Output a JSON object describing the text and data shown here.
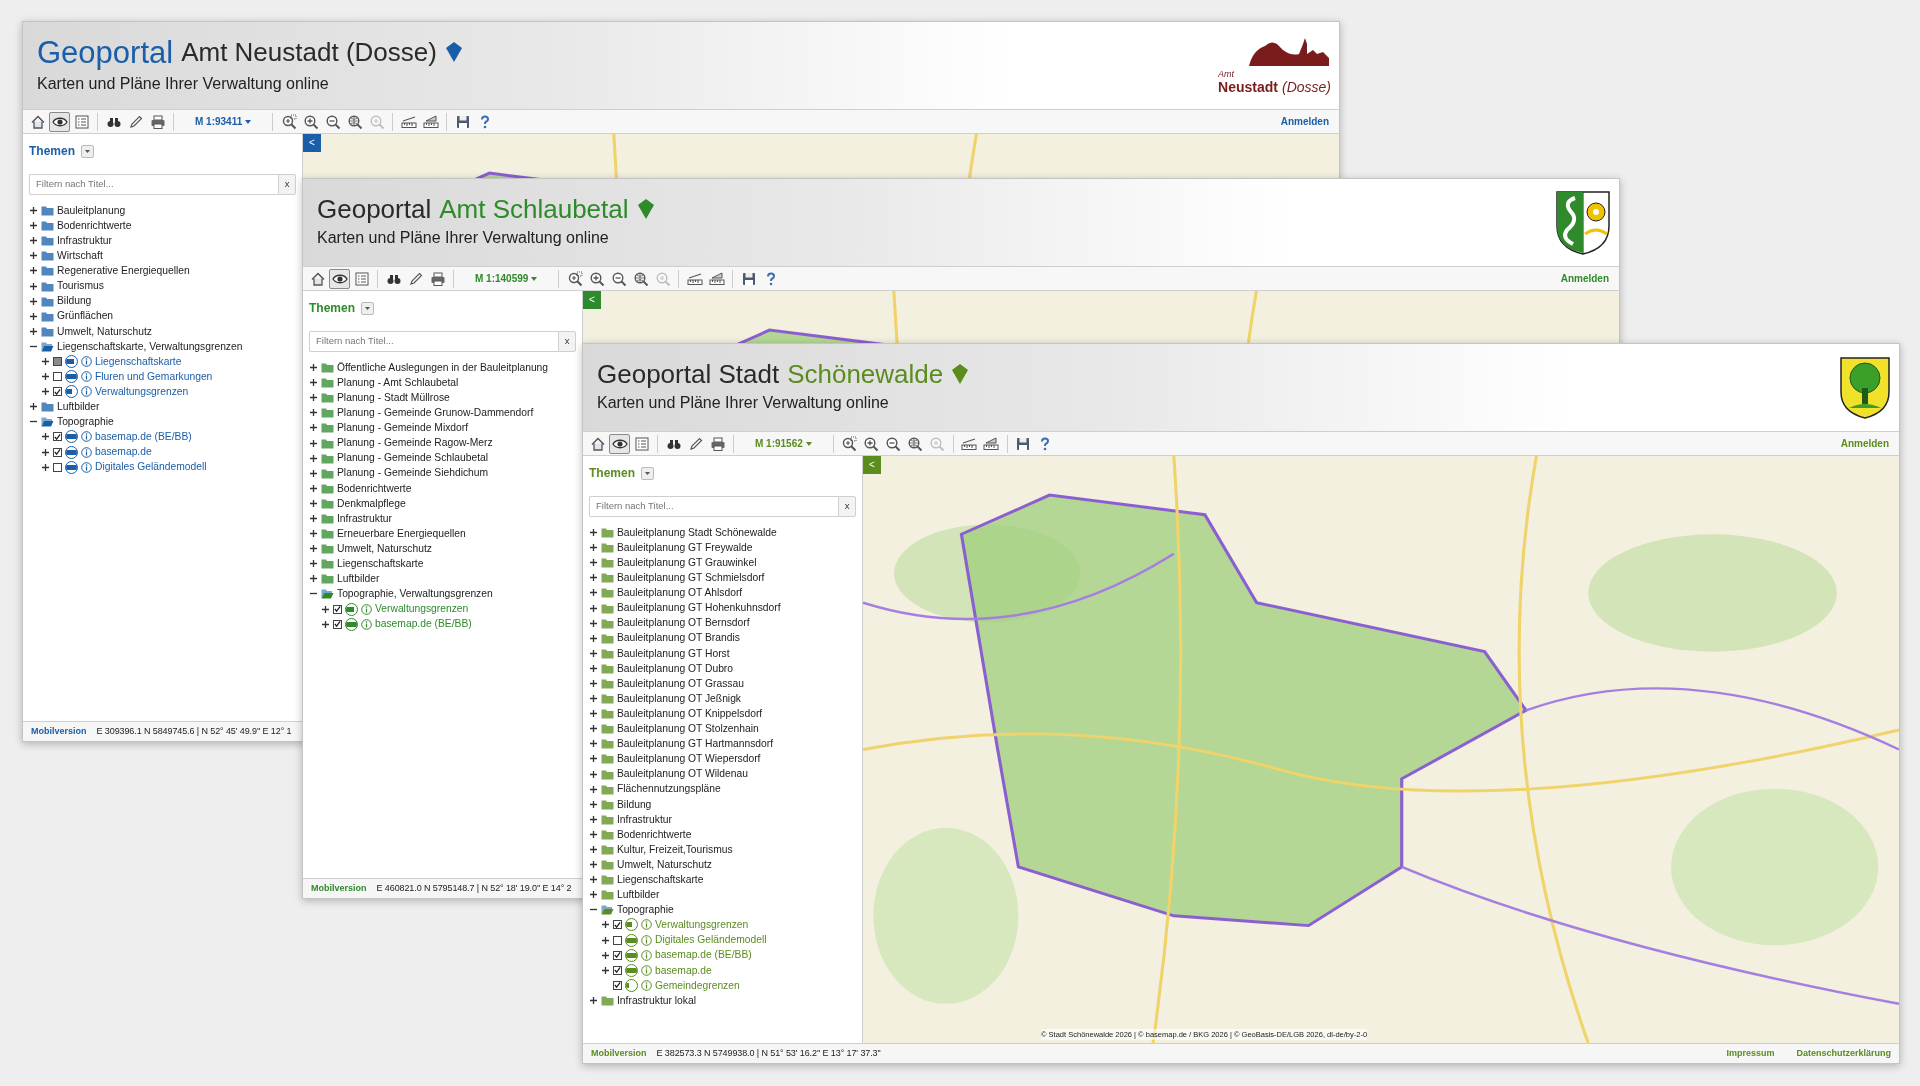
{
  "windows": [
    {
      "color": "#1b5ea8",
      "title_parts": [
        {
          "text": "Geoportal",
          "accent": true,
          "large": true
        },
        {
          "text": "Amt Neustadt (Dosse)",
          "accent": false,
          "large": false
        }
      ],
      "subtitle": "Karten und Pläne Ihrer Verwaltung online",
      "logo": {
        "kind": "horse-church",
        "texts": [
          "Amt",
          "Neustadt",
          "(Dosse)"
        ]
      },
      "toolbar": {
        "tools": [
          {
            "kind": "home",
            "selected": false,
            "disabled": false
          },
          {
            "kind": "view",
            "selected": true,
            "disabled": false
          },
          {
            "kind": "list",
            "selected": false,
            "disabled": false
          },
          {
            "kind": "separator"
          },
          {
            "kind": "binoculars",
            "selected": false,
            "disabled": false
          },
          {
            "kind": "pencil",
            "selected": false,
            "disabled": false
          },
          {
            "kind": "printer",
            "selected": false,
            "disabled": false
          },
          {
            "kind": "separator"
          },
          {
            "kind": "scale",
            "label": "M 1:93411"
          },
          {
            "kind": "separator"
          },
          {
            "kind": "zoom-box",
            "selected": false,
            "disabled": false
          },
          {
            "kind": "zoom-in",
            "selected": false,
            "disabled": false
          },
          {
            "kind": "zoom-out",
            "selected": false,
            "disabled": false
          },
          {
            "kind": "zoom-extent",
            "selected": false,
            "disabled": false
          },
          {
            "kind": "zoom-back",
            "selected": false,
            "disabled": true
          },
          {
            "kind": "separator"
          },
          {
            "kind": "measure-line",
            "selected": false,
            "disabled": false
          },
          {
            "kind": "measure-area",
            "selected": false,
            "disabled": false
          },
          {
            "kind": "separator"
          },
          {
            "kind": "save",
            "selected": false,
            "disabled": false
          },
          {
            "kind": "help",
            "selected": false,
            "disabled": false
          }
        ],
        "login": "Anmelden"
      },
      "sidebar": {
        "heading": "Themen",
        "filter": {
          "placeholder": "Filtern nach Titel...",
          "clear": "x"
        },
        "tree": [
          {
            "label": "Bauleitplanung",
            "kind": "group",
            "expanded": false
          },
          {
            "label": "Bodenrichtwerte",
            "kind": "group",
            "expanded": false
          },
          {
            "label": "Infrastruktur",
            "kind": "group",
            "expanded": false
          },
          {
            "label": "Wirtschaft",
            "kind": "group",
            "expanded": false
          },
          {
            "label": "Regenerative Energiequellen",
            "kind": "group",
            "expanded": false
          },
          {
            "label": "Tourismus",
            "kind": "group",
            "expanded": false
          },
          {
            "label": "Bildung",
            "kind": "group",
            "expanded": false
          },
          {
            "label": "Grünflächen",
            "kind": "group",
            "expanded": false
          },
          {
            "label": "Umwelt, Naturschutz",
            "kind": "group",
            "expanded": false
          },
          {
            "label": "Liegenschaftskarte, Verwaltungsgrenzen",
            "kind": "group",
            "expanded": true,
            "children": [
              {
                "label": "Liegenschaftskarte",
                "kind": "layer",
                "checked": false,
                "indeterminate": true,
                "level": 0.75
              },
              {
                "label": "Fluren und Gemarkungen",
                "kind": "layer",
                "checked": false,
                "indeterminate": false,
                "level": 1
              },
              {
                "label": "Verwaltungsgrenzen",
                "kind": "layer",
                "checked": true,
                "indeterminate": false,
                "level": 0.5
              }
            ]
          },
          {
            "label": "Luftbilder",
            "kind": "group",
            "expanded": false
          },
          {
            "label": "Topographie",
            "kind": "group",
            "expanded": true,
            "children": [
              {
                "label": "basemap.de (BE/BB)",
                "kind": "layer",
                "checked": true,
                "indeterminate": false,
                "level": 1
              },
              {
                "label": "basemap.de",
                "kind": "layer",
                "checked": true,
                "indeterminate": false,
                "level": 1
              },
              {
                "label": "Digitales Geländemodell",
                "kind": "layer",
                "checked": false,
                "indeterminate": false,
                "level": 1
              }
            ]
          }
        ]
      },
      "collapse_button": "<",
      "status_bar": {
        "mobile_link": "Mobilversion",
        "coordinates": "E 309396.1 N 5849745.6 | N 52° 45' 49.9'' E 12° 1"
      }
    },
    {
      "color": "#2e8a2a",
      "title_parts": [
        {
          "text": "Geoportal",
          "accent": false,
          "large": false
        },
        {
          "text": "Amt Schlaubetal",
          "accent": true,
          "large": false
        }
      ],
      "subtitle": "Karten und Pläne Ihrer Verwaltung online",
      "logo": {
        "kind": "crest-snake-gear"
      },
      "toolbar": {
        "tools": [
          {
            "kind": "home",
            "selected": false,
            "disabled": false
          },
          {
            "kind": "view",
            "selected": true,
            "disabled": false
          },
          {
            "kind": "list",
            "selected": false,
            "disabled": false
          },
          {
            "kind": "separator"
          },
          {
            "kind": "binoculars",
            "selected": false,
            "disabled": false
          },
          {
            "kind": "pencil",
            "selected": false,
            "disabled": false
          },
          {
            "kind": "printer",
            "selected": false,
            "disabled": false
          },
          {
            "kind": "separator"
          },
          {
            "kind": "scale",
            "label": "M 1:140599"
          },
          {
            "kind": "separator"
          },
          {
            "kind": "zoom-box",
            "selected": false,
            "disabled": false
          },
          {
            "kind": "zoom-in",
            "selected": false,
            "disabled": false
          },
          {
            "kind": "zoom-out",
            "selected": false,
            "disabled": false
          },
          {
            "kind": "zoom-extent",
            "selected": false,
            "disabled": false
          },
          {
            "kind": "zoom-back",
            "selected": false,
            "disabled": true
          },
          {
            "kind": "separator"
          },
          {
            "kind": "measure-line",
            "selected": false,
            "disabled": false
          },
          {
            "kind": "measure-area",
            "selected": false,
            "disabled": false
          },
          {
            "kind": "separator"
          },
          {
            "kind": "save",
            "selected": false,
            "disabled": false
          },
          {
            "kind": "help",
            "selected": false,
            "disabled": false
          }
        ],
        "login": "Anmelden"
      },
      "sidebar": {
        "heading": "Themen",
        "filter": {
          "placeholder": "Filtern nach Titel...",
          "clear": "x"
        },
        "tree": [
          {
            "label": "Öffentliche Auslegungen in der Bauleitplanung",
            "kind": "group",
            "expanded": false
          },
          {
            "label": "Planung - Amt Schlaubetal",
            "kind": "group",
            "expanded": false
          },
          {
            "label": "Planung - Stadt Müllrose",
            "kind": "group",
            "expanded": false
          },
          {
            "label": "Planung - Gemeinde Grunow-Dammendorf",
            "kind": "group",
            "expanded": false
          },
          {
            "label": "Planung - Gemeinde Mixdorf",
            "kind": "group",
            "expanded": false
          },
          {
            "label": "Planung - Gemeinde Ragow-Merz",
            "kind": "group",
            "expanded": false
          },
          {
            "label": "Planung - Gemeinde Schlaubetal",
            "kind": "group",
            "expanded": false
          },
          {
            "label": "Planung - Gemeinde Siehdichum",
            "kind": "group",
            "expanded": false
          },
          {
            "label": "Bodenrichtwerte",
            "kind": "group",
            "expanded": false
          },
          {
            "label": "Denkmalpflege",
            "kind": "group",
            "expanded": false
          },
          {
            "label": "Infrastruktur",
            "kind": "group",
            "expanded": false
          },
          {
            "label": "Erneuerbare Energiequellen",
            "kind": "group",
            "expanded": false
          },
          {
            "label": "Umwelt, Naturschutz",
            "kind": "group",
            "expanded": false
          },
          {
            "label": "Liegenschaftskarte",
            "kind": "group",
            "expanded": false
          },
          {
            "label": "Luftbilder",
            "kind": "group",
            "expanded": false
          },
          {
            "label": "Topographie, Verwaltungsgrenzen",
            "kind": "group",
            "expanded": true,
            "children": [
              {
                "label": "Verwaltungsgrenzen",
                "kind": "layer",
                "checked": true,
                "indeterminate": false,
                "level": 0.75
              },
              {
                "label": "basemap.de (BE/BB)",
                "kind": "layer",
                "checked": true,
                "indeterminate": false,
                "level": 1
              }
            ]
          }
        ]
      },
      "collapse_button": "<",
      "status_bar": {
        "mobile_link": "Mobilversion",
        "coordinates": "E 460821.0 N 5795148.7 | N 52° 18' 19.0'' E 14° 2"
      }
    },
    {
      "color": "#5a8c1e",
      "title_parts": [
        {
          "text": "Geoportal Stadt",
          "accent": false,
          "large": false
        },
        {
          "text": "Schönewalde",
          "accent": true,
          "large": false
        }
      ],
      "subtitle": "Karten und Pläne Ihrer Verwaltung online",
      "logo": {
        "kind": "crest-tree"
      },
      "toolbar": {
        "tools": [
          {
            "kind": "home",
            "selected": false,
            "disabled": false
          },
          {
            "kind": "view",
            "selected": true,
            "disabled": false
          },
          {
            "kind": "list",
            "selected": false,
            "disabled": false
          },
          {
            "kind": "separator"
          },
          {
            "kind": "binoculars",
            "selected": false,
            "disabled": false
          },
          {
            "kind": "pencil",
            "selected": false,
            "disabled": false
          },
          {
            "kind": "printer",
            "selected": false,
            "disabled": false
          },
          {
            "kind": "separator"
          },
          {
            "kind": "scale",
            "label": "M 1:91562"
          },
          {
            "kind": "separator"
          },
          {
            "kind": "zoom-box",
            "selected": false,
            "disabled": false
          },
          {
            "kind": "zoom-in",
            "selected": false,
            "disabled": false
          },
          {
            "kind": "zoom-out",
            "selected": false,
            "disabled": false
          },
          {
            "kind": "zoom-extent",
            "selected": false,
            "disabled": false
          },
          {
            "kind": "zoom-back",
            "selected": false,
            "disabled": true
          },
          {
            "kind": "separator"
          },
          {
            "kind": "measure-line",
            "selected": false,
            "disabled": false
          },
          {
            "kind": "measure-area",
            "selected": false,
            "disabled": false
          },
          {
            "kind": "separator"
          },
          {
            "kind": "save",
            "selected": false,
            "disabled": false
          },
          {
            "kind": "help",
            "selected": false,
            "disabled": false
          }
        ],
        "login": "Anmelden"
      },
      "sidebar": {
        "heading": "Themen",
        "filter": {
          "placeholder": "Filtern nach Titel...",
          "clear": "x"
        },
        "tree": [
          {
            "label": "Bauleitplanung Stadt Schönewalde",
            "kind": "group",
            "expanded": false
          },
          {
            "label": "Bauleitplanung GT Freywalde",
            "kind": "group",
            "expanded": false
          },
          {
            "label": "Bauleitplanung GT Grauwinkel",
            "kind": "group",
            "expanded": false
          },
          {
            "label": "Bauleitplanung GT Schmielsdorf",
            "kind": "group",
            "expanded": false
          },
          {
            "label": "Bauleitplanung OT Ahlsdorf",
            "kind": "group",
            "expanded": false
          },
          {
            "label": "Bauleitplanung GT Hohenkuhnsdorf",
            "kind": "group",
            "expanded": false
          },
          {
            "label": "Bauleitplanung OT Bernsdorf",
            "kind": "group",
            "expanded": false
          },
          {
            "label": "Bauleitplanung OT Brandis",
            "kind": "group",
            "expanded": false
          },
          {
            "label": "Bauleitplanung GT Horst",
            "kind": "group",
            "expanded": false
          },
          {
            "label": "Bauleitplanung OT Dubro",
            "kind": "group",
            "expanded": false
          },
          {
            "label": "Bauleitplanung OT Grassau",
            "kind": "group",
            "expanded": false
          },
          {
            "label": "Bauleitplanung OT Jeßnigk",
            "kind": "group",
            "expanded": false
          },
          {
            "label": "Bauleitplanung OT Knippelsdorf",
            "kind": "group",
            "expanded": false
          },
          {
            "label": "Bauleitplanung OT Stolzenhain",
            "kind": "group",
            "expanded": false
          },
          {
            "label": "Bauleitplanung GT Hartmannsdorf",
            "kind": "group",
            "expanded": false
          },
          {
            "label": "Bauleitplanung OT Wiepersdorf",
            "kind": "group",
            "expanded": false
          },
          {
            "label": "Bauleitplanung OT Wildenau",
            "kind": "group",
            "expanded": false
          },
          {
            "label": "Flächennutzungspläne",
            "kind": "group",
            "expanded": false
          },
          {
            "label": "Bildung",
            "kind": "group",
            "expanded": false
          },
          {
            "label": "Infrastruktur",
            "kind": "group",
            "expanded": false
          },
          {
            "label": "Bodenrichtwerte",
            "kind": "group",
            "expanded": false
          },
          {
            "label": "Kultur, Freizeit,Tourismus",
            "kind": "group",
            "expanded": false
          },
          {
            "label": "Umwelt, Naturschutz",
            "kind": "group",
            "expanded": false
          },
          {
            "label": "Liegenschaftskarte",
            "kind": "group",
            "expanded": false
          },
          {
            "label": "Luftbilder",
            "kind": "group",
            "expanded": false
          },
          {
            "label": "Topographie",
            "kind": "group",
            "expanded": true,
            "children": [
              {
                "label": "Verwaltungsgrenzen",
                "kind": "layer",
                "checked": true,
                "indeterminate": false,
                "level": 0.5
              },
              {
                "label": "Digitales Geländemodell",
                "kind": "layer",
                "checked": false,
                "indeterminate": false,
                "level": 1
              },
              {
                "label": "basemap.de (BE/BB)",
                "kind": "layer",
                "checked": true,
                "indeterminate": false,
                "level": 1
              },
              {
                "label": "basemap.de",
                "kind": "layer",
                "checked": true,
                "indeterminate": false,
                "level": 1
              },
              {
                "label": "Gemeindegrenzen",
                "kind": "single-layer",
                "checked": true,
                "indeterminate": false,
                "level": 0.25
              }
            ]
          },
          {
            "label": "Infrastruktur lokal",
            "kind": "group",
            "expanded": false
          }
        ]
      },
      "collapse_button": "<",
      "map_attribution": "© Stadt Schönewalde 2026 | © basemap.de / BKG 2026 | © GeoBasis-DE/LGB 2026, dl-de/by-2-0",
      "status_bar": {
        "mobile_link": "Mobilversion",
        "coordinates": "E 382573.3 N 5749938.0 | N 51° 53' 16.2'' E 13° 17' 37.3''",
        "links": [
          "Impressum",
          "Datenschutzerklärung"
        ]
      }
    }
  ]
}
